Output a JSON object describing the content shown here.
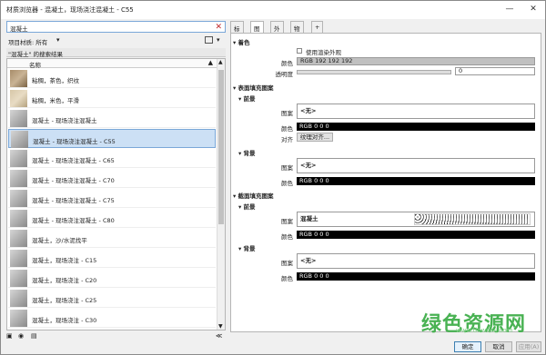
{
  "window": {
    "title": "材质浏览器 - 混凝土，现场浇注混凝土 - C55",
    "minimize": "—",
    "close": "✕"
  },
  "search": {
    "value": "混凝土",
    "clear": "✕"
  },
  "filter": {
    "label": "项目材质: 所有",
    "arrow": "▾",
    "view_arrow": "▾"
  },
  "section": {
    "label": "\"混凝土\" 的搜索结果"
  },
  "list": {
    "column": "名称",
    "sort_arrow": "▲",
    "items": [
      {
        "name": "粘稠，茶色，织纹",
        "swatch": "wood"
      },
      {
        "name": "粘稠，米色，平滑",
        "swatch": "beige"
      },
      {
        "name": "混凝土 - 现场浇注混凝土",
        "swatch": "gray"
      },
      {
        "name": "混凝土 - 现场浇注混凝土 - C55",
        "swatch": "gray",
        "selected": true
      },
      {
        "name": "混凝土 - 现场浇注混凝土 - C65",
        "swatch": "gray"
      },
      {
        "name": "混凝土 - 现场浇注混凝土 - C70",
        "swatch": "gray"
      },
      {
        "name": "混凝土 - 现场浇注混凝土 - C75",
        "swatch": "gray"
      },
      {
        "name": "混凝土 - 现场浇注混凝土 - C80",
        "swatch": "gray"
      },
      {
        "name": "混凝土，沙/水泥找平",
        "swatch": "gray"
      },
      {
        "name": "混凝土，现场浇注 - C15",
        "swatch": "gray"
      },
      {
        "name": "混凝土，现场浇注 - C20",
        "swatch": "gray"
      },
      {
        "name": "混凝土，现场浇注 - C25",
        "swatch": "gray"
      },
      {
        "name": "混凝土，现场浇注 - C30",
        "swatch": "gray"
      },
      {
        "name": "混凝土，现场浇注 - C35",
        "swatch": "gray"
      }
    ]
  },
  "left_footer": {
    "collapse": "≪"
  },
  "tabs": [
    "标识",
    "图形",
    "外观",
    "物理",
    "+"
  ],
  "shading": {
    "header": "▾ 着色",
    "use_render_label": "使用渲染外观",
    "color_label": "颜色",
    "color_value": "RGB 192 192 192",
    "transparency_label": "透明度",
    "transparency_value": "0"
  },
  "surface": {
    "header": "▾ 表面填充图案",
    "fore": {
      "header": "▾ 前景",
      "pattern_label": "图案",
      "pattern_value": "<无>",
      "color_label": "颜色",
      "color_value": "RGB 0 0 0",
      "align_label": "对齐",
      "align_button": "纹理对齐..."
    },
    "back": {
      "header": "▾ 背景",
      "pattern_label": "图案",
      "pattern_value": "<无>",
      "color_label": "颜色",
      "color_value": "RGB 0 0 0"
    }
  },
  "cut": {
    "header": "▾ 截面填充图案",
    "fore": {
      "header": "▾ 前景",
      "pattern_label": "图案",
      "pattern_value": "混凝土",
      "color_label": "颜色",
      "color_value": "RGB 0 0 0"
    },
    "back": {
      "header": "▾ 背景",
      "pattern_label": "图案",
      "pattern_value": "<无>",
      "color_label": "颜色",
      "color_value": "RGB 0 0 0"
    }
  },
  "buttons": {
    "ok": "确定",
    "cancel": "取消",
    "apply": "应用(A)"
  },
  "watermark": {
    "main": "绿色资源网",
    "sub": "www.downcc.com"
  }
}
